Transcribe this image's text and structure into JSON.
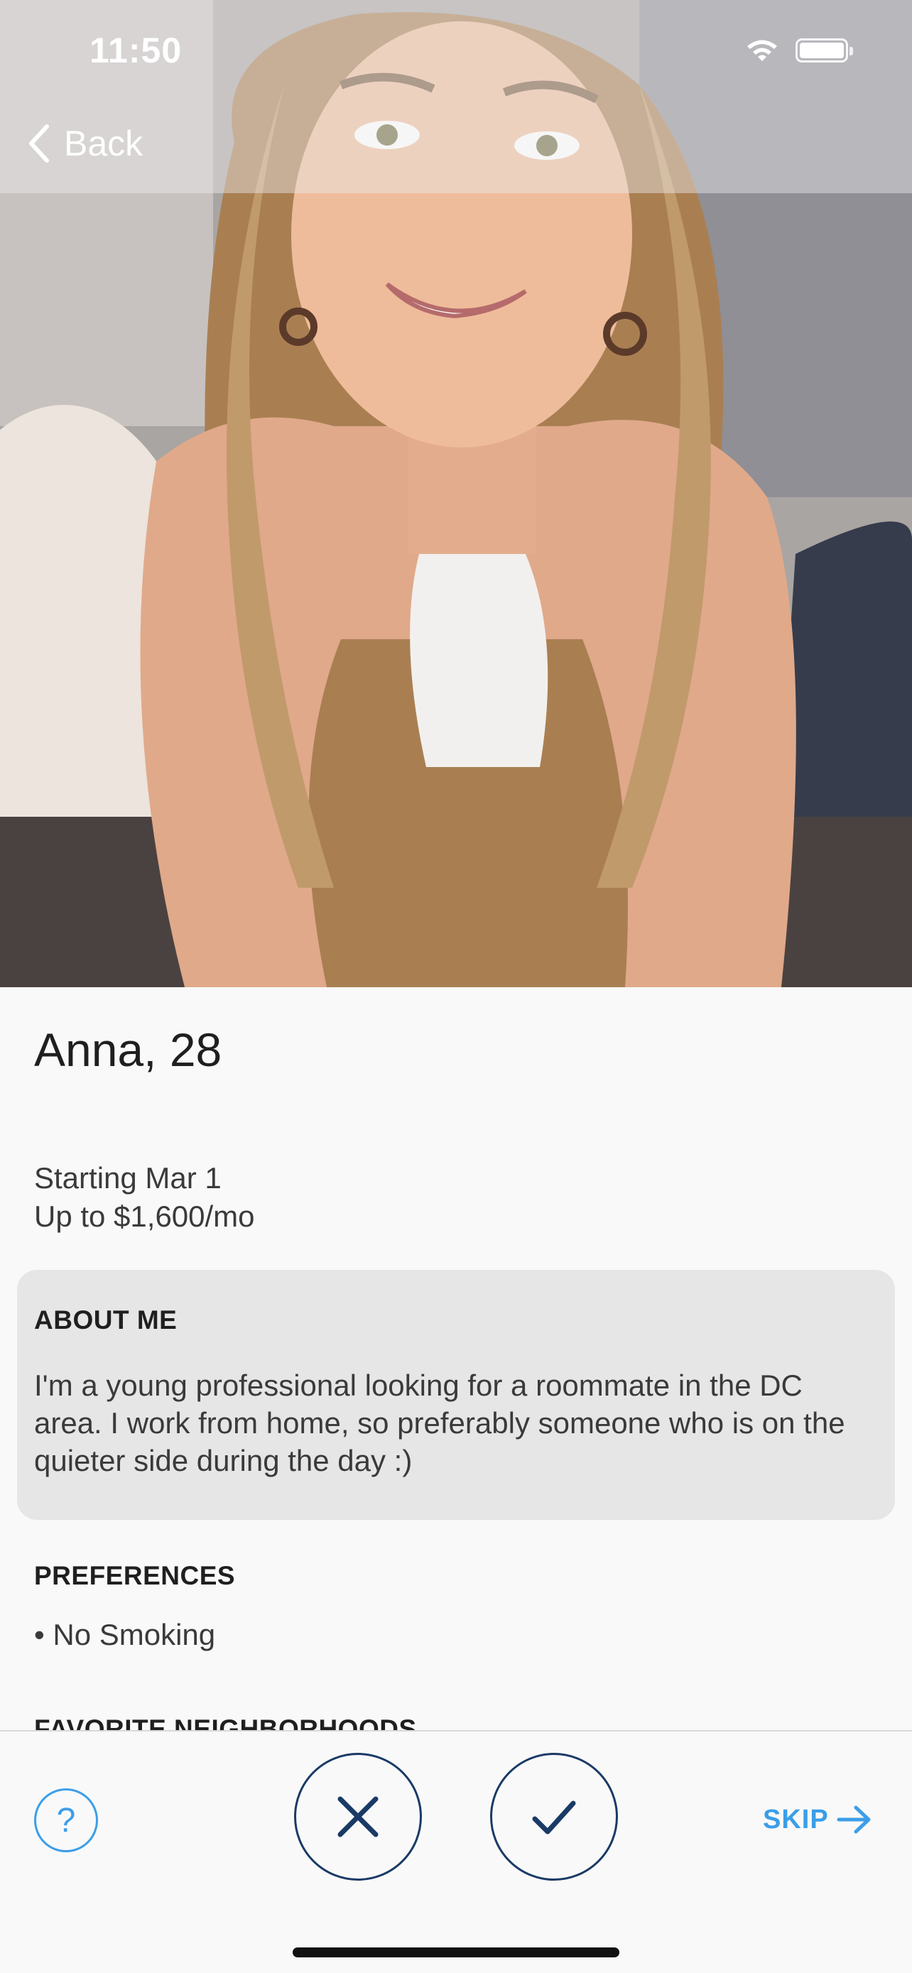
{
  "status_bar": {
    "time": "11:50",
    "wifi_icon": "wifi-icon",
    "battery_icon": "battery-icon"
  },
  "nav": {
    "back_label": "Back",
    "back_icon": "chevron-left-icon"
  },
  "profile": {
    "name_age": "Anna, 28",
    "start": "Starting Mar 1",
    "budget": "Up to $1,600/mo",
    "about_title": "ABOUT ME",
    "about_text": "I'm a young professional looking for a roommate in the DC area. I work from home, so preferably someone who is on the quieter side during the day :)",
    "preferences_title": "PREFERENCES",
    "preferences": [
      "• No Smoking"
    ],
    "favorite_neighborhoods_title": "FAVORITE NEIGHBORHOODS"
  },
  "actions": {
    "help_label": "?",
    "reject_icon": "x-icon",
    "accept_icon": "check-icon",
    "skip_label": "SKIP",
    "skip_icon": "arrow-right-icon"
  },
  "colors": {
    "accent_blue": "#3b9ee8",
    "action_navy": "#1a3a66",
    "card_bg": "#e6e6e6"
  }
}
